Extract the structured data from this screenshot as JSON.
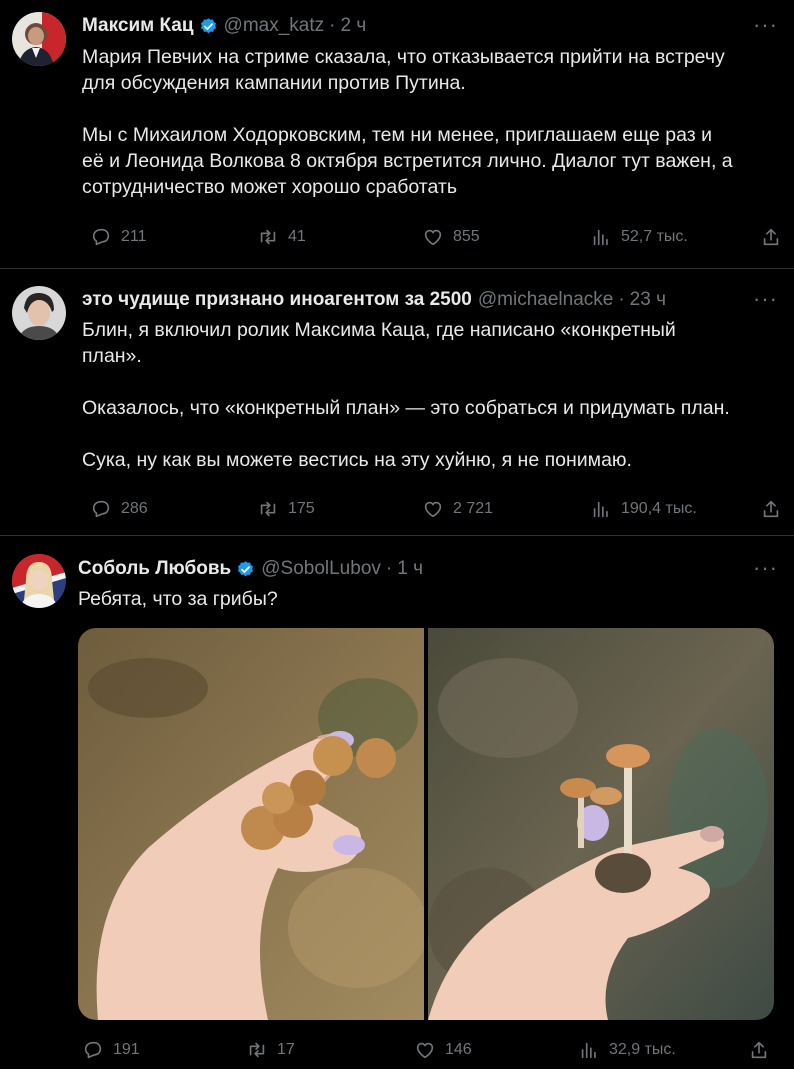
{
  "tweets": [
    {
      "name": "Максим Кац",
      "handle": "@max_katz",
      "dot": "·",
      "time": "2 ч",
      "verified": true,
      "more": "···",
      "text": "Мария Певчих на стриме сказала, что отказывается прийти на встречу\nдля обсуждения кампании против Путина.\n\nМы с Михаилом Ходорковским, тем ни менее, приглашаем еще раз и\nеё и Леонида Волкова 8 октября встретится лично. Диалог тут важен, а\nсотрудничество может хорошо сработать",
      "replies": "211",
      "retweets": "41",
      "likes": "855",
      "views": "52,7 тыс."
    },
    {
      "name": "это чудище признано иноагентом за 2500",
      "handle": "@michaelnacke",
      "dot": "·",
      "time": "23 ч",
      "verified": false,
      "more": "···",
      "text": "Блин, я включил ролик Максима Каца, где написано «конкретный\nплан».\n\nОказалось, что «конкретный план» — это собраться и придумать план.\n\nСука, ну как вы можете вестись на эту хуйню, я не понимаю.",
      "replies": "286",
      "retweets": "175",
      "likes": "2 721",
      "views": "190,4 тыс."
    },
    {
      "name": "Соболь Любовь",
      "handle": "@SobolLubov",
      "dot": "·",
      "time": "1 ч",
      "verified": true,
      "more": "···",
      "text": "Ребята, что за грибы?",
      "replies": "191",
      "retweets": "17",
      "likes": "146",
      "views": "32,9 тыс.",
      "photos": [
        "hand-holding-mushrooms-photo-1",
        "hand-holding-mushrooms-photo-2"
      ]
    }
  ],
  "colors": {
    "background": "#000000",
    "text": "#e7e9ea",
    "muted": "#71767b",
    "divider": "#2f3336",
    "verified": "#1d9bf0"
  },
  "icons": [
    "reply-icon",
    "retweet-icon",
    "like-icon",
    "views-icon",
    "share-icon",
    "verified-badge-icon",
    "more-icon"
  ]
}
